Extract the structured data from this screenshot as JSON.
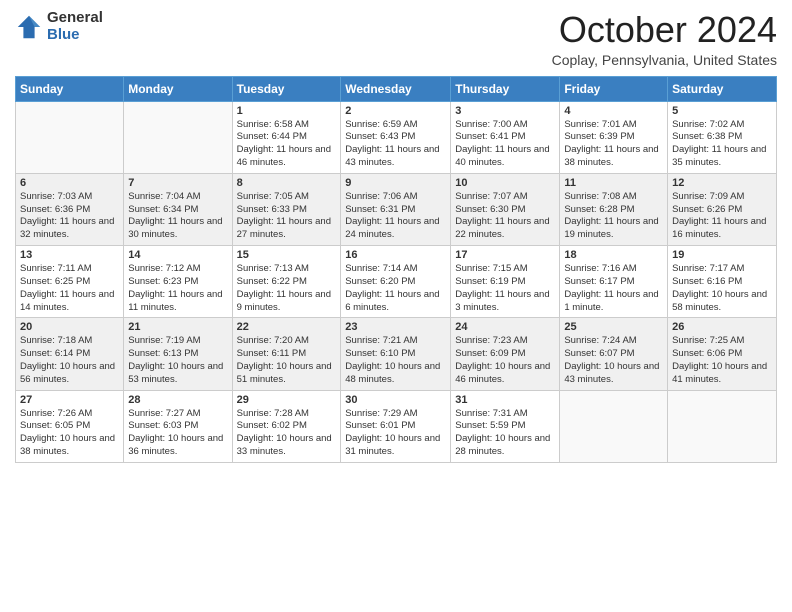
{
  "logo": {
    "general": "General",
    "blue": "Blue"
  },
  "title": "October 2024",
  "location": "Coplay, Pennsylvania, United States",
  "days_of_week": [
    "Sunday",
    "Monday",
    "Tuesday",
    "Wednesday",
    "Thursday",
    "Friday",
    "Saturday"
  ],
  "weeks": [
    [
      {
        "day": "",
        "info": ""
      },
      {
        "day": "",
        "info": ""
      },
      {
        "day": "1",
        "info": "Sunrise: 6:58 AM\nSunset: 6:44 PM\nDaylight: 11 hours and 46 minutes."
      },
      {
        "day": "2",
        "info": "Sunrise: 6:59 AM\nSunset: 6:43 PM\nDaylight: 11 hours and 43 minutes."
      },
      {
        "day": "3",
        "info": "Sunrise: 7:00 AM\nSunset: 6:41 PM\nDaylight: 11 hours and 40 minutes."
      },
      {
        "day": "4",
        "info": "Sunrise: 7:01 AM\nSunset: 6:39 PM\nDaylight: 11 hours and 38 minutes."
      },
      {
        "day": "5",
        "info": "Sunrise: 7:02 AM\nSunset: 6:38 PM\nDaylight: 11 hours and 35 minutes."
      }
    ],
    [
      {
        "day": "6",
        "info": "Sunrise: 7:03 AM\nSunset: 6:36 PM\nDaylight: 11 hours and 32 minutes."
      },
      {
        "day": "7",
        "info": "Sunrise: 7:04 AM\nSunset: 6:34 PM\nDaylight: 11 hours and 30 minutes."
      },
      {
        "day": "8",
        "info": "Sunrise: 7:05 AM\nSunset: 6:33 PM\nDaylight: 11 hours and 27 minutes."
      },
      {
        "day": "9",
        "info": "Sunrise: 7:06 AM\nSunset: 6:31 PM\nDaylight: 11 hours and 24 minutes."
      },
      {
        "day": "10",
        "info": "Sunrise: 7:07 AM\nSunset: 6:30 PM\nDaylight: 11 hours and 22 minutes."
      },
      {
        "day": "11",
        "info": "Sunrise: 7:08 AM\nSunset: 6:28 PM\nDaylight: 11 hours and 19 minutes."
      },
      {
        "day": "12",
        "info": "Sunrise: 7:09 AM\nSunset: 6:26 PM\nDaylight: 11 hours and 16 minutes."
      }
    ],
    [
      {
        "day": "13",
        "info": "Sunrise: 7:11 AM\nSunset: 6:25 PM\nDaylight: 11 hours and 14 minutes."
      },
      {
        "day": "14",
        "info": "Sunrise: 7:12 AM\nSunset: 6:23 PM\nDaylight: 11 hours and 11 minutes."
      },
      {
        "day": "15",
        "info": "Sunrise: 7:13 AM\nSunset: 6:22 PM\nDaylight: 11 hours and 9 minutes."
      },
      {
        "day": "16",
        "info": "Sunrise: 7:14 AM\nSunset: 6:20 PM\nDaylight: 11 hours and 6 minutes."
      },
      {
        "day": "17",
        "info": "Sunrise: 7:15 AM\nSunset: 6:19 PM\nDaylight: 11 hours and 3 minutes."
      },
      {
        "day": "18",
        "info": "Sunrise: 7:16 AM\nSunset: 6:17 PM\nDaylight: 11 hours and 1 minute."
      },
      {
        "day": "19",
        "info": "Sunrise: 7:17 AM\nSunset: 6:16 PM\nDaylight: 10 hours and 58 minutes."
      }
    ],
    [
      {
        "day": "20",
        "info": "Sunrise: 7:18 AM\nSunset: 6:14 PM\nDaylight: 10 hours and 56 minutes."
      },
      {
        "day": "21",
        "info": "Sunrise: 7:19 AM\nSunset: 6:13 PM\nDaylight: 10 hours and 53 minutes."
      },
      {
        "day": "22",
        "info": "Sunrise: 7:20 AM\nSunset: 6:11 PM\nDaylight: 10 hours and 51 minutes."
      },
      {
        "day": "23",
        "info": "Sunrise: 7:21 AM\nSunset: 6:10 PM\nDaylight: 10 hours and 48 minutes."
      },
      {
        "day": "24",
        "info": "Sunrise: 7:23 AM\nSunset: 6:09 PM\nDaylight: 10 hours and 46 minutes."
      },
      {
        "day": "25",
        "info": "Sunrise: 7:24 AM\nSunset: 6:07 PM\nDaylight: 10 hours and 43 minutes."
      },
      {
        "day": "26",
        "info": "Sunrise: 7:25 AM\nSunset: 6:06 PM\nDaylight: 10 hours and 41 minutes."
      }
    ],
    [
      {
        "day": "27",
        "info": "Sunrise: 7:26 AM\nSunset: 6:05 PM\nDaylight: 10 hours and 38 minutes."
      },
      {
        "day": "28",
        "info": "Sunrise: 7:27 AM\nSunset: 6:03 PM\nDaylight: 10 hours and 36 minutes."
      },
      {
        "day": "29",
        "info": "Sunrise: 7:28 AM\nSunset: 6:02 PM\nDaylight: 10 hours and 33 minutes."
      },
      {
        "day": "30",
        "info": "Sunrise: 7:29 AM\nSunset: 6:01 PM\nDaylight: 10 hours and 31 minutes."
      },
      {
        "day": "31",
        "info": "Sunrise: 7:31 AM\nSunset: 5:59 PM\nDaylight: 10 hours and 28 minutes."
      },
      {
        "day": "",
        "info": ""
      },
      {
        "day": "",
        "info": ""
      }
    ]
  ]
}
